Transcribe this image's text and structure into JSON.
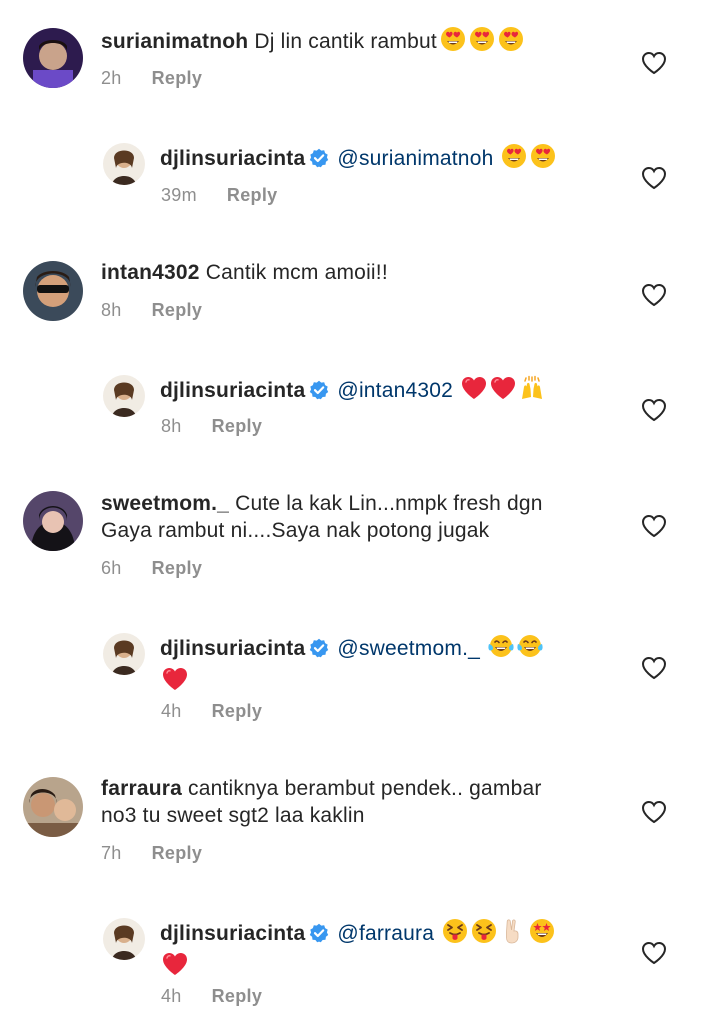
{
  "reply_label": "Reply",
  "comments": [
    {
      "user": "surianimatnoh",
      "text": "Dj lin cantik rambut",
      "emojis": [
        "heart-eyes",
        "heart-eyes",
        "heart-eyes"
      ],
      "time": "2h"
    },
    {
      "user": "djlinsuriacinta",
      "verified": true,
      "mention": "@surianimatnoh",
      "text": "",
      "emojis": [
        "heart-eyes",
        "heart-eyes"
      ],
      "time": "39m"
    },
    {
      "user": "intan4302",
      "text": "Cantik mcm amoii!!",
      "emojis": [],
      "time": "8h"
    },
    {
      "user": "djlinsuriacinta",
      "verified": true,
      "mention": "@intan4302",
      "text": "",
      "emojis": [
        "red-heart",
        "red-heart",
        "raising-hands"
      ],
      "time": "8h"
    },
    {
      "user": "sweetmom._",
      "text_line1": "Cute la kak Lin...nmpk fresh dgn",
      "text_line2": "Gaya rambut ni....Saya nak potong jugak",
      "emojis": [],
      "time": "6h"
    },
    {
      "user": "djlinsuriacinta",
      "verified": true,
      "mention": "@sweetmom._",
      "text": "",
      "emojis": [
        "tears-of-joy",
        "tears-of-joy"
      ],
      "emojis_line2": [
        "red-heart"
      ],
      "time": "4h"
    },
    {
      "user": "farraura",
      "text_line1": "cantiknya berambut pendek.. gambar",
      "text_line2": "no3 tu sweet sgt2 laa kaklin",
      "emojis": [],
      "time": "7h"
    },
    {
      "user": "djlinsuriacinta",
      "verified": true,
      "mention": "@farraura",
      "text": "",
      "emojis": [
        "squinting-tongue",
        "squinting-tongue",
        "victory-hand",
        "star-struck"
      ],
      "emojis_line2": [
        "red-heart"
      ],
      "time": "4h"
    }
  ],
  "colors": {
    "text": "#262626",
    "meta": "#8e8e8e",
    "mention": "#00376b",
    "verified": "#3897f0",
    "heart-red": "#ed4956"
  }
}
